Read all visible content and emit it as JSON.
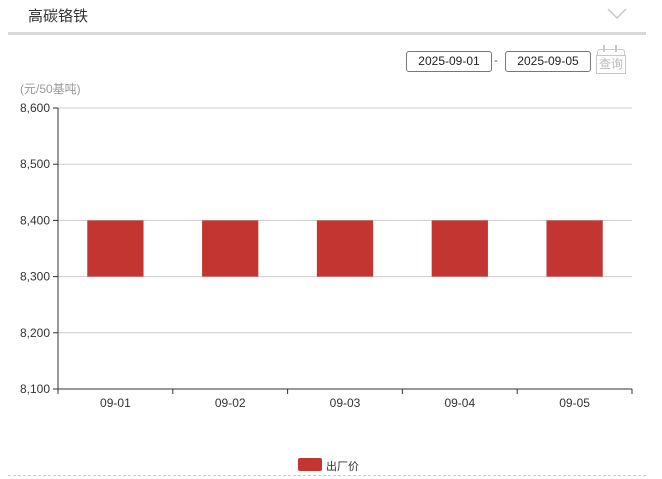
{
  "header": {
    "title": "高碳铬铁"
  },
  "filter": {
    "start_date": "2025-09-01",
    "end_date": "2025-09-05",
    "separator": "-",
    "query_label": "查询"
  },
  "colors": {
    "bar": "#c23531",
    "grid": "#cccccc",
    "axis": "#333333"
  },
  "chart_data": {
    "type": "bar",
    "unit_label": "(元/50基吨)",
    "categories": [
      "09-01",
      "09-02",
      "09-03",
      "09-04",
      "09-05"
    ],
    "series": [
      {
        "name": "出厂价",
        "low": [
          8300,
          8300,
          8300,
          8300,
          8300
        ],
        "high": [
          8400,
          8400,
          8400,
          8400,
          8400
        ]
      }
    ],
    "ylim": [
      8100,
      8600
    ],
    "yticks": [
      8100,
      8200,
      8300,
      8400,
      8500,
      8600
    ],
    "ytick_labels": [
      "8,100",
      "8,200",
      "8,300",
      "8,400",
      "8,500",
      "8,600"
    ],
    "grid": true,
    "legend_position": "bottom-center"
  }
}
